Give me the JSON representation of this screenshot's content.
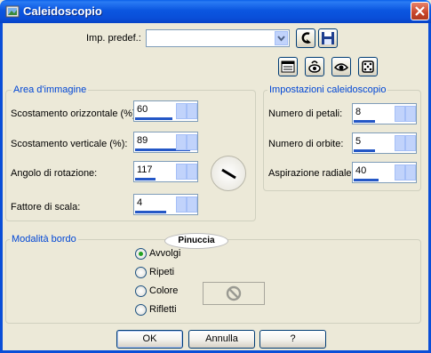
{
  "window": {
    "title": "Caleidoscopio"
  },
  "preset": {
    "label": "Imp. predef.:",
    "value": ""
  },
  "area": {
    "title": "Area d'immagine",
    "fields": [
      {
        "label": "Scostamento orizzontale (%):",
        "value": "60",
        "level": 60
      },
      {
        "label": "Scostamento verticale (%):",
        "value": "89",
        "level": 89
      },
      {
        "label": "Angolo di rotazione:",
        "value": "117",
        "level": 33
      },
      {
        "label": "Fattore di scala:",
        "value": "4",
        "level": 75
      }
    ]
  },
  "kaleido": {
    "title": "Impostazioni caleidoscopio",
    "fields": [
      {
        "label": "Numero di petali:",
        "value": "8",
        "level": 35
      },
      {
        "label": "Numero di orbite:",
        "value": "5",
        "level": 35
      },
      {
        "label": "Aspirazione radiale:",
        "value": "40",
        "level": 40
      }
    ]
  },
  "edge": {
    "title": "Modalità bordo",
    "watermark": "Pinuccia",
    "options": [
      "Avvolgi",
      "Ripeti",
      "Colore",
      "Rifletti"
    ],
    "selected": "Avvolgi"
  },
  "buttons": {
    "ok": "OK",
    "cancel": "Annulla",
    "help": "?"
  },
  "colors": {
    "accent": "#0046d5",
    "titlebar": "#0a4ed8",
    "face": "#ece9d8"
  }
}
